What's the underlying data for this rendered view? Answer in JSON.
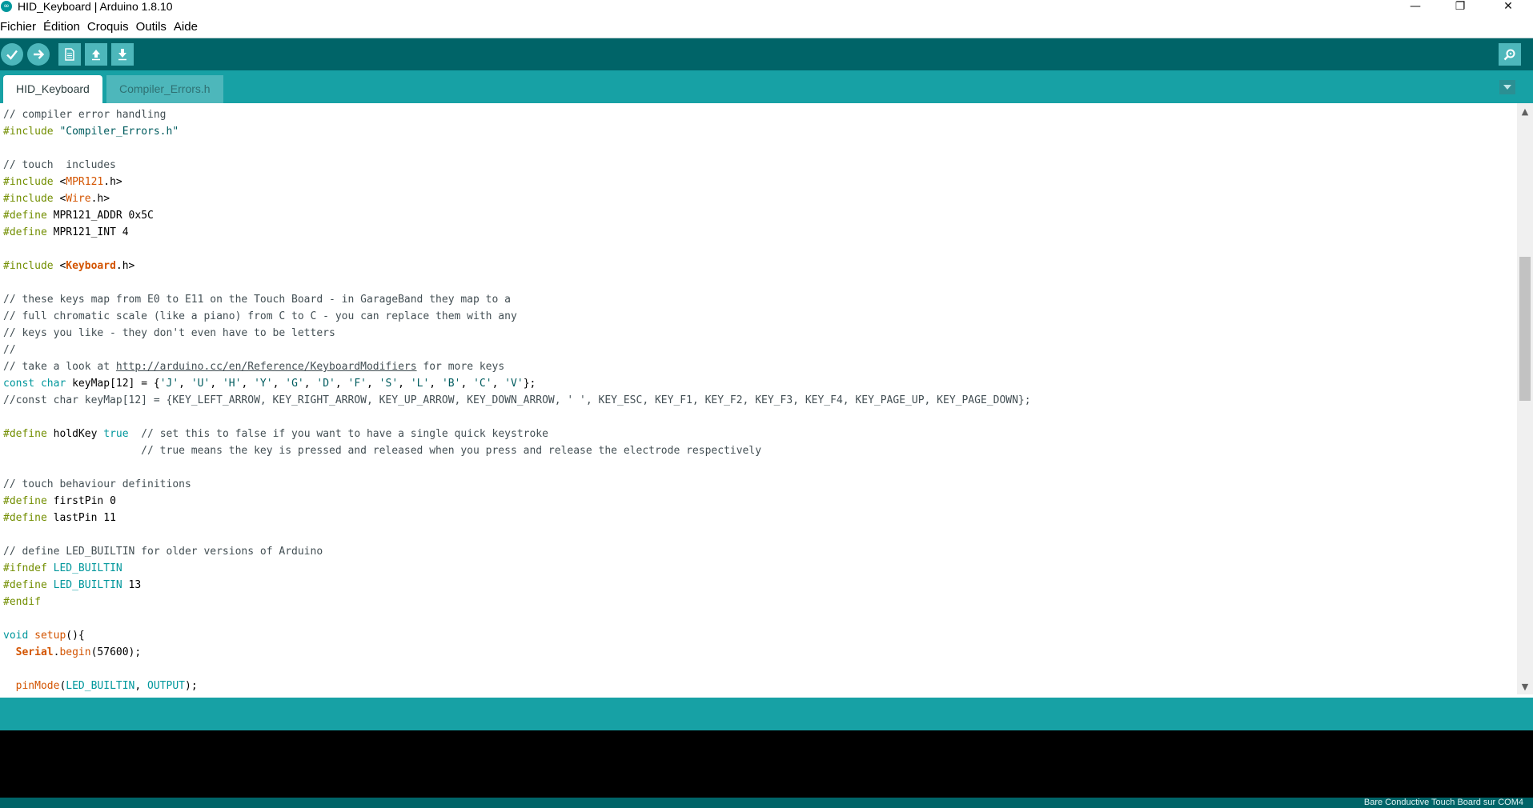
{
  "window": {
    "title": "HID_Keyboard | Arduino 1.8.10",
    "app_icon": "∞",
    "minimize": "—",
    "restore": "❐",
    "close": "✕"
  },
  "menu": [
    "Fichier",
    "Édition",
    "Croquis",
    "Outils",
    "Aide"
  ],
  "toolbar": {
    "buttons": [
      "verify-icon",
      "upload-icon",
      "new-icon",
      "open-icon",
      "save-icon",
      "serial-monitor-icon"
    ]
  },
  "tabs": [
    {
      "label": "HID_Keyboard",
      "active": true
    },
    {
      "label": "Compiler_Errors.h",
      "active": false
    }
  ],
  "code": {
    "inc1_comment": "// compiler error handling",
    "inc1_directive": "#include",
    "inc1_string": "\"Compiler_Errors.h\"",
    "touch_comment": "// touch  includes",
    "inc2_directive": "#include",
    "inc2_lib": "MPR121",
    "inc3_directive": "#include",
    "inc3_lib": "Wire",
    "def1_directive": "#define",
    "def1_rest": "MPR121_ADDR 0x5C",
    "def2_directive": "#define",
    "def2_rest": "MPR121_INT 4",
    "inc4_directive": "#include",
    "inc4_lib": "Keyboard",
    "c1": "// these keys map from E0 to E11 on the Touch Board - in GarageBand they map to a",
    "c2": "// full chromatic scale (like a piano) from C to C - you can replace them with any",
    "c3": "// keys you like - they don't even have to be letters",
    "c4": "//",
    "c5_pre": "// take a look at ",
    "c5_link": "http://arduino.cc/en/Reference/KeyboardModifiers",
    "c5_post": " for more keys",
    "keymap_const": "const",
    "keymap_char": "char",
    "keymap_name": " keyMap[12] = {",
    "keymap_values": [
      "'J'",
      "'U'",
      "'H'",
      "'Y'",
      "'G'",
      "'D'",
      "'F'",
      "'S'",
      "'L'",
      "'B'",
      "'C'",
      "'V'"
    ],
    "keymap_end": "};",
    "keymap_alt": "//const char keyMap[12] = {KEY_LEFT_ARROW, KEY_RIGHT_ARROW, KEY_UP_ARROW, KEY_DOWN_ARROW, ' ', KEY_ESC, KEY_F1, KEY_F2, KEY_F3, KEY_F4, KEY_PAGE_UP, KEY_PAGE_DOWN};",
    "hold_directive": "#define",
    "hold_name": " holdKey ",
    "hold_value": "true",
    "hold_comment1": "  // set this to false if you want to have a single quick keystroke",
    "hold_comment2": "                      // true means the key is pressed and released when you press and release the electrode respectively",
    "behav_comment": "// touch behaviour definitions",
    "first_directive": "#define",
    "first_rest": " firstPin 0",
    "last_directive": "#define",
    "last_rest": " lastPin 11",
    "led_comment": "// define LED_BUILTIN for older versions of Arduino",
    "ifndef_directive": "#ifndef",
    "ifndef_name": "LED_BUILTIN",
    "define_led_directive": "#define",
    "define_led_name": "LED_BUILTIN",
    "define_led_value": " 13",
    "endif_directive": "#endif",
    "setup_void": "void",
    "setup_name": "setup",
    "setup_rest": "(){",
    "serial_obj": "Serial",
    "serial_dot": ".",
    "serial_fn": "begin",
    "serial_arg": "(57600);",
    "pinmode_fn": "pinMode",
    "pinmode_open": "(",
    "pinmode_arg1": "LED_BUILTIN",
    "pinmode_comma": ", ",
    "pinmode_arg2": "OUTPUT",
    "pinmode_close": ");"
  },
  "colors": {
    "toolbar": "#006468",
    "tabbar": "#17a1a5",
    "button": "#4db7bb",
    "console": "#000000"
  },
  "footer": {
    "board": "Bare Conductive Touch Board sur COM4"
  }
}
